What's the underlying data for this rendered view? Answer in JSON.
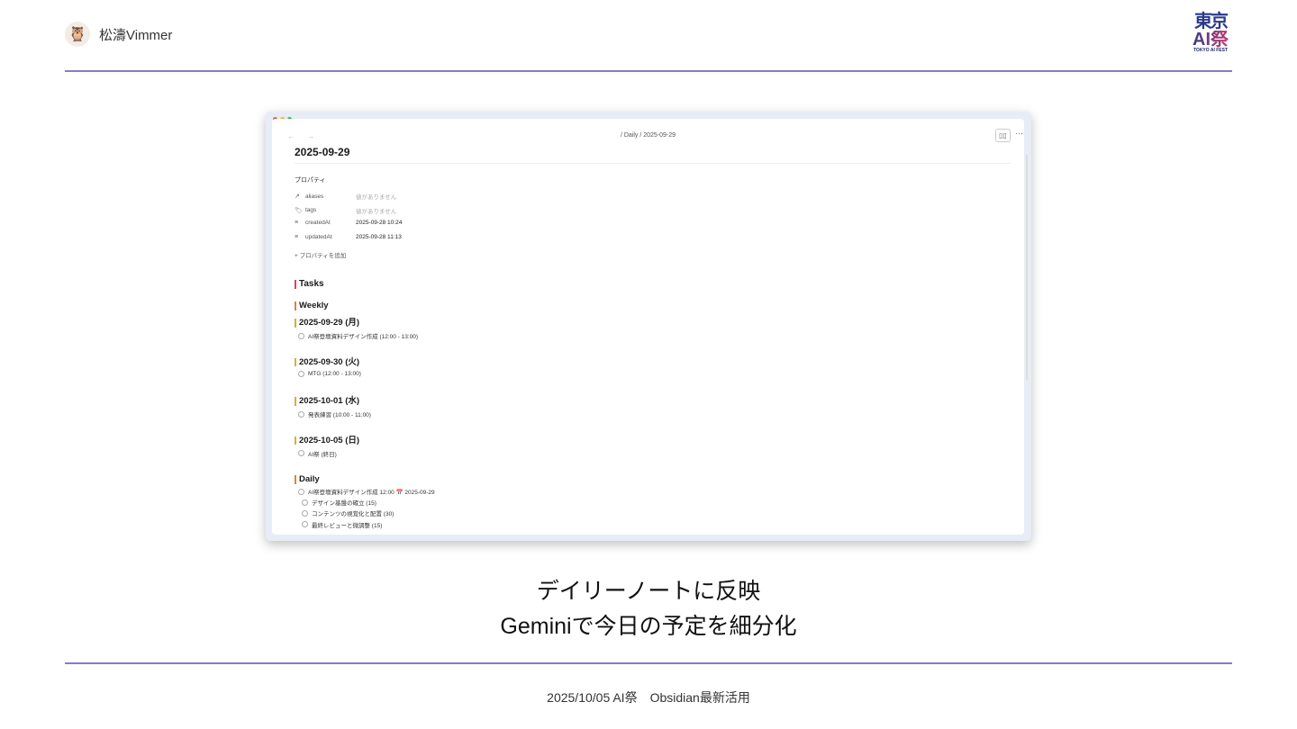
{
  "header": {
    "author": "松濤Vimmer",
    "avatar_icon": "owl-avatar",
    "logo_text": [
      "東京",
      "AI祭",
      "TOKYO AI FEST"
    ]
  },
  "window": {
    "breadcrumb": "/ Daily / 2025-09-29",
    "nav": "← →",
    "read_icon": "book-open-icon",
    "more": "···",
    "title": "2025-09-29",
    "properties_label": "プロパティ",
    "properties": [
      {
        "icon": "↗",
        "key": "aliases",
        "value": "値がありません",
        "empty": true
      },
      {
        "icon": "🏷",
        "key": "tags",
        "value": "値がありません",
        "empty": true
      },
      {
        "icon": "≡",
        "key": "createdAt",
        "value": "2025-09-28 10:24"
      },
      {
        "icon": "≡",
        "key": "updatedAt",
        "value": "2025-09-28 11:13"
      }
    ],
    "add_property": "+ プロパティを追加",
    "tasks_heading": "Tasks",
    "weekly_heading": "Weekly",
    "days": [
      {
        "date": "2025-09-29 (月)",
        "task": "AI祭登壇資料デザイン作成 (12:00 - 13:00)"
      },
      {
        "date": "2025-09-30 (火)",
        "task": "MTG (12:00 - 13:00)"
      },
      {
        "date": "2025-10-01 (水)",
        "task": "発表練習 (10:00 - 11:00)"
      },
      {
        "date": "2025-10-05 (日)",
        "task": "AI祭 (終日)"
      }
    ],
    "daily_heading": "Daily",
    "daily_task": "AI祭登壇資料デザイン作成 12:00 📅 2025-09-29",
    "subtasks": [
      "デザイン基盤の確立 (15)",
      "コンテンツの視覚化と配置 (30)",
      "最終レビューと微調整 (15)"
    ]
  },
  "caption": {
    "line1": "デイリーノートに反映",
    "line2": "Geminiで今日の予定を細分化"
  },
  "footer": "2025/10/05 AI祭　Obsidian最新活用",
  "colors": {
    "accent_rule": "#8a78c8",
    "h1": "#e04050",
    "h2": "#e08040",
    "h3": "#d8b030"
  }
}
